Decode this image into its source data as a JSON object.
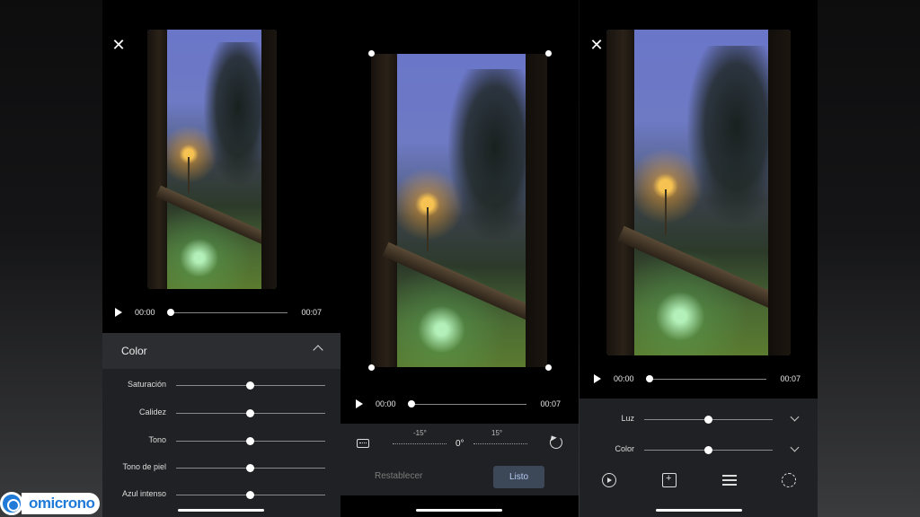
{
  "screen1": {
    "close_icon": "close-icon",
    "timeline": {
      "start": "00:00",
      "end": "00:07",
      "position": 0.0
    },
    "panel": {
      "title": "Color",
      "sliders": [
        {
          "label": "Saturación",
          "value": 0.5
        },
        {
          "label": "Calidez",
          "value": 0.5
        },
        {
          "label": "Tono",
          "value": 0.5
        },
        {
          "label": "Tono de piel",
          "value": 0.5
        },
        {
          "label": "Azul intenso",
          "value": 0.5
        }
      ]
    }
  },
  "screen2": {
    "timeline": {
      "start": "00:00",
      "end": "00:07",
      "position": 0.0
    },
    "rotation": {
      "left": "-15°",
      "center": "0°",
      "right": "15°"
    },
    "reset_label": "Restablecer",
    "done_label": "Listo"
  },
  "screen3": {
    "close_icon": "close-icon",
    "timeline": {
      "start": "00:00",
      "end": "00:07",
      "position": 0.0
    },
    "adjustments": [
      {
        "label": "Luz",
        "value": 0.5
      },
      {
        "label": "Color",
        "value": 0.5
      }
    ],
    "toolbar": [
      "play-circle-icon",
      "export-frame-icon",
      "adjust-icon",
      "crop-rotate-icon"
    ]
  },
  "watermark": {
    "text": "omicrono"
  },
  "colors": {
    "accent_button_bg": "#3c4758",
    "accent_button_text": "#b6cbf4",
    "panel_bg": "#202124"
  }
}
